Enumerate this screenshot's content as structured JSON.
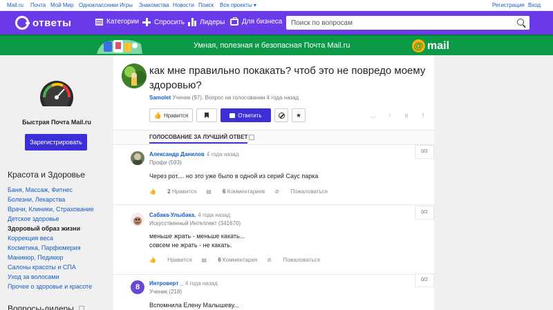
{
  "topbar": {
    "links": [
      "Mail.ru",
      "Почта",
      "Мой Мир",
      "Одноклассники",
      "Игры",
      "Знакомства",
      "Новости",
      "Поиск",
      "Все проекты ▾"
    ],
    "register": "Регистрация",
    "login": "Вход"
  },
  "header": {
    "logo_text": "ответы",
    "nav": [
      "Категории",
      "Спросить",
      "Лидеры",
      "Для бизнеса"
    ],
    "search_placeholder": "Поиск по вопросам",
    "bg_color": "#6b3bea"
  },
  "banner": {
    "text": "Умная, полезная и безопасная Почта Mail.ru",
    "logo_symbol": "@",
    "logo_word": "mail",
    "bg_color": "#0d9a47"
  },
  "sidebar": {
    "promo_title": "Быстрая Почта Mail.ru",
    "register_button": "Зарегистрировать",
    "category_title": "Красота и Здоровье",
    "categories": [
      "Баня, Массаж, Фитнес",
      "Болезни, Лекарства",
      "Врачи, Клиники, Страхование",
      "Детское здоровье",
      "Здоровый образ жизни",
      "Коррекция веса",
      "Косметика, Парфюмерия",
      "Маникюр, Педикюр",
      "Салоны красоты и СПА",
      "Уход за волосами",
      "Прочее о здоровье и красоте"
    ],
    "active_category_index": 4,
    "leaders_title": "Вопросы-лидеры"
  },
  "question": {
    "title": "как мне правильно покакать? чтоб это не повредо моему здоровью?",
    "author": "Samolet",
    "meta": "Ученик (97). Вопрос на голосовании 4 года назад",
    "buttons": {
      "like": "Нравится",
      "answer": "Ответить"
    }
  },
  "voting": {
    "header": "ГОЛОСОВАНИЕ ЗА ЛУЧШИЙ ОТВЕТ"
  },
  "answers": [
    {
      "name": "Александр Данилов",
      "time": "4 года назад",
      "rank": "Профи (593)",
      "lines": [
        "Через рот.... но это уже было в одной из серий Саус парка"
      ],
      "likes": "2",
      "like_label": "Нравится",
      "comments": "6",
      "comments_label": "Комментариев",
      "complain": "Пожаловаться",
      "score": "0/2"
    },
    {
      "name": "Сабака-Улыбака.",
      "time": "4 года назад",
      "rank": "Искусственный Интеллект (341670)",
      "lines": [
        "меньше жрать - меньше какать...",
        "совсем не жрать - не какать."
      ],
      "likes": "",
      "like_label": "Нравится",
      "comments": "6",
      "comments_label": "Комментария",
      "complain": "Пожаловаться",
      "score": "0/2"
    },
    {
      "name": "Интроверт _",
      "time": "4 года назад",
      "rank": "Ученик (218)",
      "avatar_letter": "8",
      "lines": [
        "Вспомнила Елену Малышеву..."
      ],
      "score": "0/2"
    }
  ]
}
